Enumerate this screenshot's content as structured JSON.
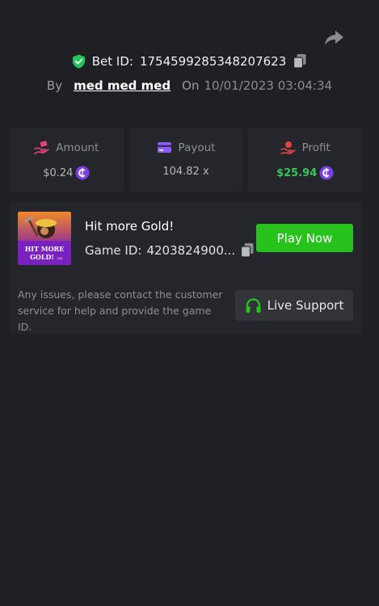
{
  "header": {
    "share_icon": "share-arrow-icon",
    "bet_id_label": "Bet ID:",
    "bet_id": "1754599285348207623",
    "by_label": "By",
    "username": "med med med",
    "on_label": "On",
    "datetime": "10/01/2023 03:04:34"
  },
  "stats": {
    "amount": {
      "label": "Amount",
      "value": "$0.24",
      "icon": "hand-bet-icon"
    },
    "payout": {
      "label": "Payout",
      "value": "104.82 x",
      "icon": "card-icon"
    },
    "profit": {
      "label": "Profit",
      "value": "$25.94",
      "icon": "hand-money-icon"
    }
  },
  "game": {
    "title": "Hit more Gold!",
    "id_label": "Game ID:",
    "id_value": "4203824900...",
    "thumbnail_text": "HIT MORE GOLD!",
    "play_label": "Play Now"
  },
  "support": {
    "help_text": "Any issues, please contact the customer service for help and provide the game ID.",
    "button_label": "Live Support"
  },
  "colors": {
    "background": "#1f2024",
    "card": "#25262b",
    "accent_green": "#27c21c",
    "profit_green": "#34c759",
    "coin_purple": "#7b3fe4",
    "shield_green": "#22c55e"
  }
}
